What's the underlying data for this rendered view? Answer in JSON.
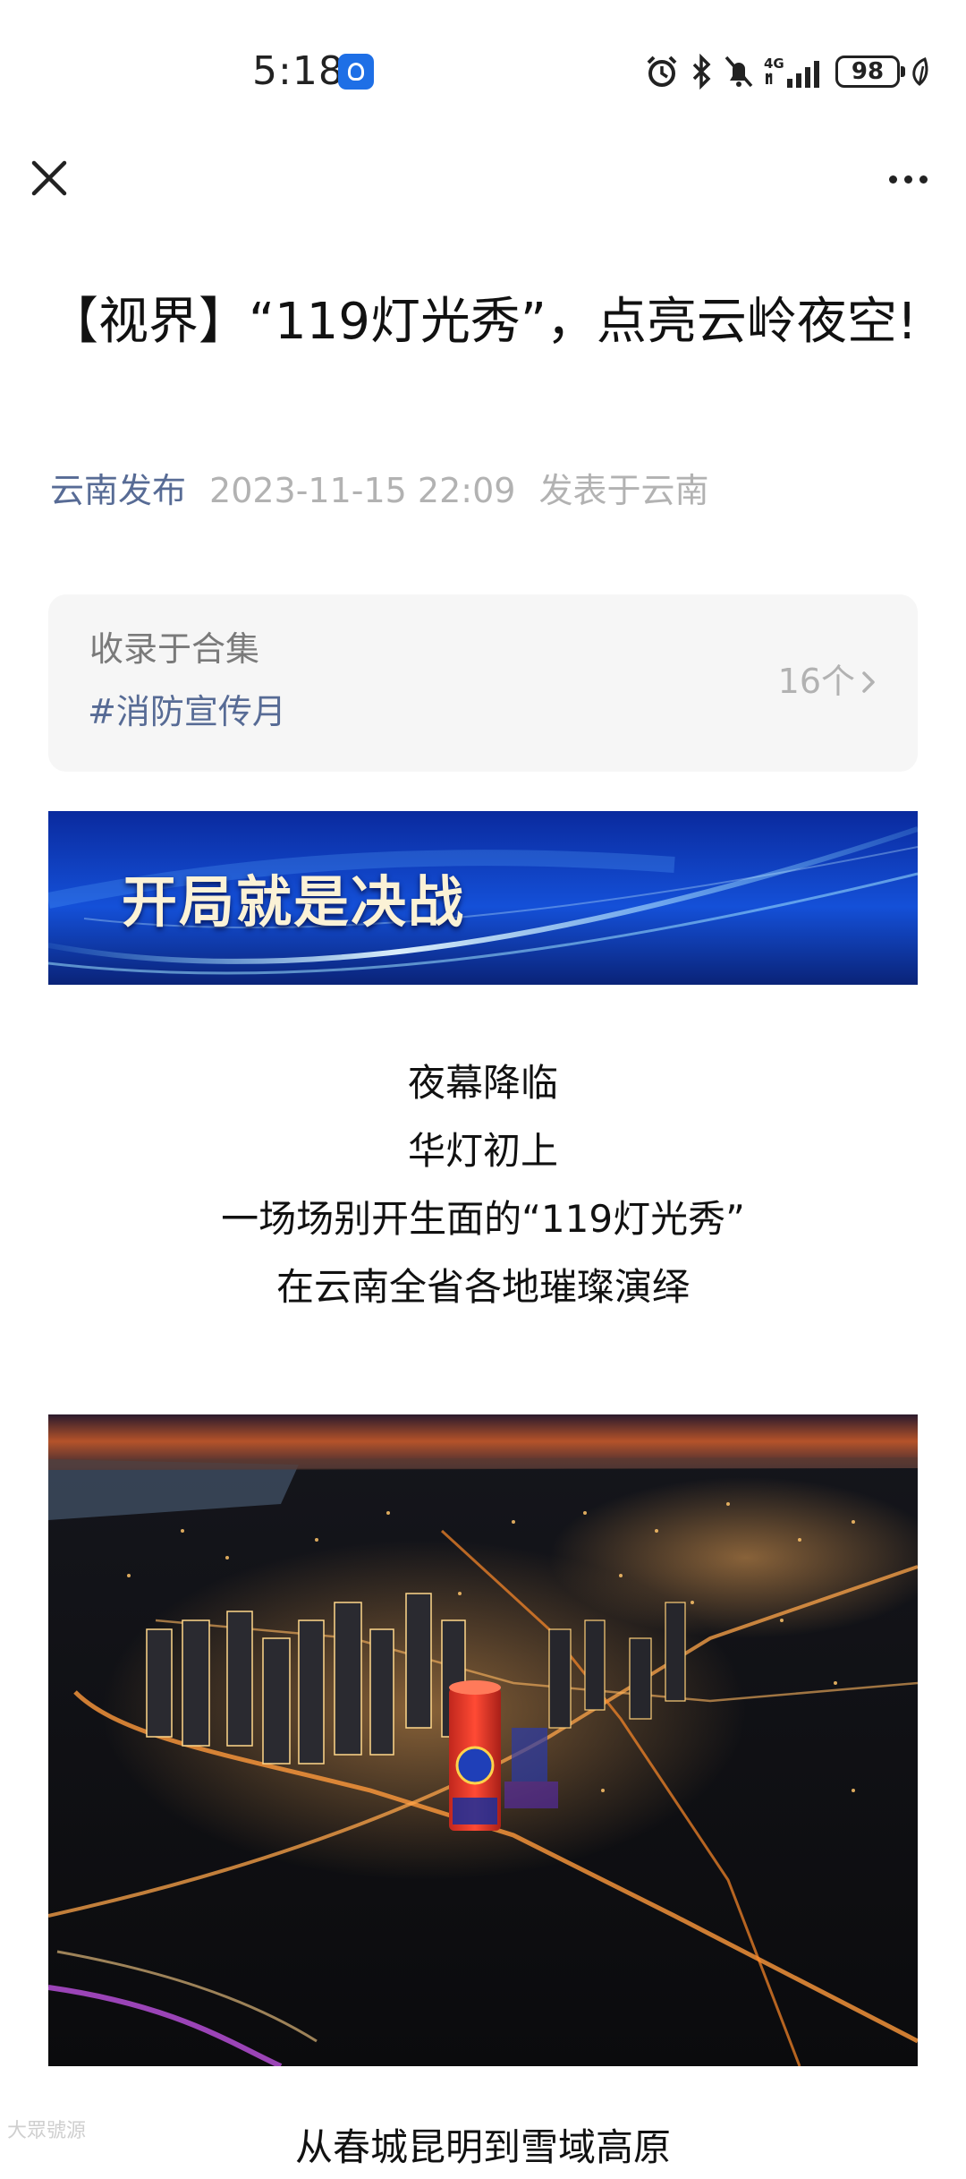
{
  "status_bar": {
    "time": "5:18",
    "battery": "98",
    "network": "4G",
    "icons": [
      "app-notification-icon",
      "alarm-icon",
      "bluetooth-icon",
      "mute-icon",
      "signal-icon",
      "battery-icon",
      "leaf-icon"
    ]
  },
  "nav": {
    "icons": [
      "close-icon",
      "more-icon"
    ]
  },
  "article": {
    "title": "【视界】“119灯光秀”，点亮云岭夜空!",
    "author": "云南发布",
    "date": "2023-11-15 22:09",
    "location": "发表于云南"
  },
  "collection": {
    "label": "收录于合集",
    "tag": "#消防宣传月",
    "count": "16个"
  },
  "banner": {
    "text": "开局就是决战"
  },
  "poem": {
    "lines": [
      "夜幕降临",
      "华灯初上",
      "一场场别开生面的“119灯光秀”",
      "在云南全省各地璀璨演绎"
    ]
  },
  "next_line": "从春城昆明到雪域高原",
  "watermark": "大眾號源",
  "colors": {
    "link": "#576b95",
    "muted": "#b2b2b2",
    "card_bg": "#f6f6f6"
  }
}
